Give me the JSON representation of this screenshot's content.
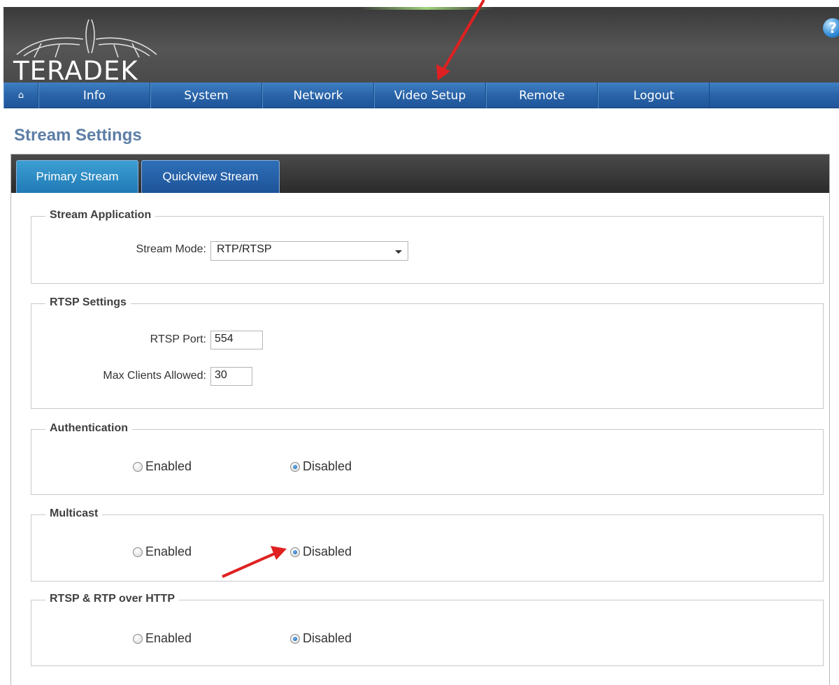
{
  "header": {
    "logo_text": "TERADEK",
    "help_icon": "?"
  },
  "nav": {
    "home_icon": "⌂",
    "items": [
      "Info",
      "System",
      "Network",
      "Video Setup",
      "Remote",
      "Logout"
    ]
  },
  "page_title": "Stream Settings",
  "tabs": [
    "Primary Stream",
    "Quickview Stream"
  ],
  "stream_application": {
    "legend": "Stream Application",
    "mode_label": "Stream Mode:",
    "mode_value": "RTP/RTSP"
  },
  "rtsp_settings": {
    "legend": "RTSP Settings",
    "port_label": "RTSP Port:",
    "port_value": "554",
    "max_clients_label": "Max Clients Allowed:",
    "max_clients_value": "30"
  },
  "authentication": {
    "legend": "Authentication",
    "enabled": "Enabled",
    "disabled": "Disabled",
    "selected": "Disabled"
  },
  "multicast": {
    "legend": "Multicast",
    "enabled": "Enabled",
    "disabled": "Disabled",
    "selected": "Disabled"
  },
  "rtsp_over_http": {
    "legend": "RTSP & RTP over HTTP",
    "enabled": "Enabled",
    "disabled": "Disabled",
    "selected": "Disabled"
  },
  "colors": {
    "annotation_arrow": "#e02020",
    "nav_blue": "#2a64a8",
    "title_blue": "#5d7ea6"
  }
}
